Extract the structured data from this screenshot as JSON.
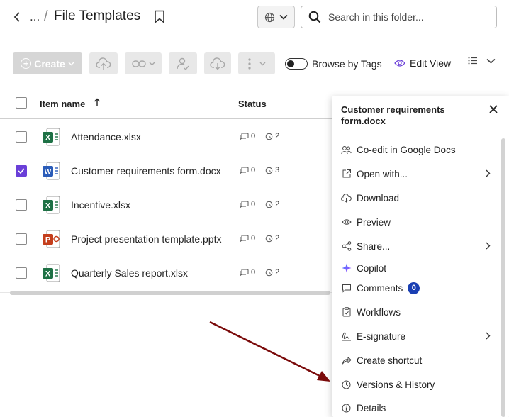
{
  "header": {
    "breadcrumb_ellipsis": "...",
    "breadcrumb_separator": "/",
    "title": "File Templates",
    "search_placeholder": "Search in this folder..."
  },
  "toolbar": {
    "create_label": "Create",
    "browse_by_tags_label": "Browse by Tags",
    "browse_by_tags_on": false,
    "edit_view_label": "Edit View"
  },
  "table": {
    "columns": {
      "name": "Item name",
      "status": "Status"
    },
    "sort": "ascending",
    "rows": [
      {
        "name": "Attendance.xlsx",
        "type": "excel",
        "checked": false,
        "comments": "0",
        "versions": "2"
      },
      {
        "name": "Customer requirements form.docx",
        "type": "word",
        "checked": true,
        "comments": "0",
        "versions": "3"
      },
      {
        "name": "Incentive.xlsx",
        "type": "excel",
        "checked": false,
        "comments": "0",
        "versions": "2"
      },
      {
        "name": "Project presentation template.pptx",
        "type": "powerpoint",
        "checked": false,
        "comments": "0",
        "versions": "2"
      },
      {
        "name": "Quarterly Sales report.xlsx",
        "type": "excel",
        "checked": false,
        "comments": "0",
        "versions": "2"
      }
    ]
  },
  "panel": {
    "title": "Customer requirements form.docx",
    "items": [
      {
        "label": "Co-edit in Google Docs",
        "icon": "users-icon",
        "submenu": false
      },
      {
        "label": "Open with...",
        "icon": "open-external-icon",
        "submenu": true
      },
      {
        "label": "Download",
        "icon": "cloud-download-icon",
        "submenu": false
      },
      {
        "label": "Preview",
        "icon": "eye-icon",
        "submenu": false
      },
      {
        "label": "Share...",
        "icon": "share-icon",
        "submenu": true
      },
      {
        "label": "Copilot",
        "icon": "sparkle-icon",
        "submenu": false
      },
      {
        "label": "Comments",
        "icon": "comment-icon",
        "submenu": false,
        "badge": "0"
      },
      {
        "label": "Workflows",
        "icon": "clipboard-icon",
        "submenu": false
      },
      {
        "label": "E-signature",
        "icon": "signature-icon",
        "submenu": true
      },
      {
        "label": "Create shortcut",
        "icon": "shortcut-arrow-icon",
        "submenu": false
      },
      {
        "label": "Versions & History",
        "icon": "clock-icon",
        "submenu": false
      },
      {
        "label": "Details",
        "icon": "info-icon",
        "submenu": false
      }
    ]
  },
  "colors": {
    "accent": "#6a3fd8",
    "badge": "#1a3fb3",
    "annotation_arrow": "#7a0a0a",
    "excel": "#1e7145",
    "word": "#2b5cb8",
    "powerpoint": "#c43e1c"
  }
}
